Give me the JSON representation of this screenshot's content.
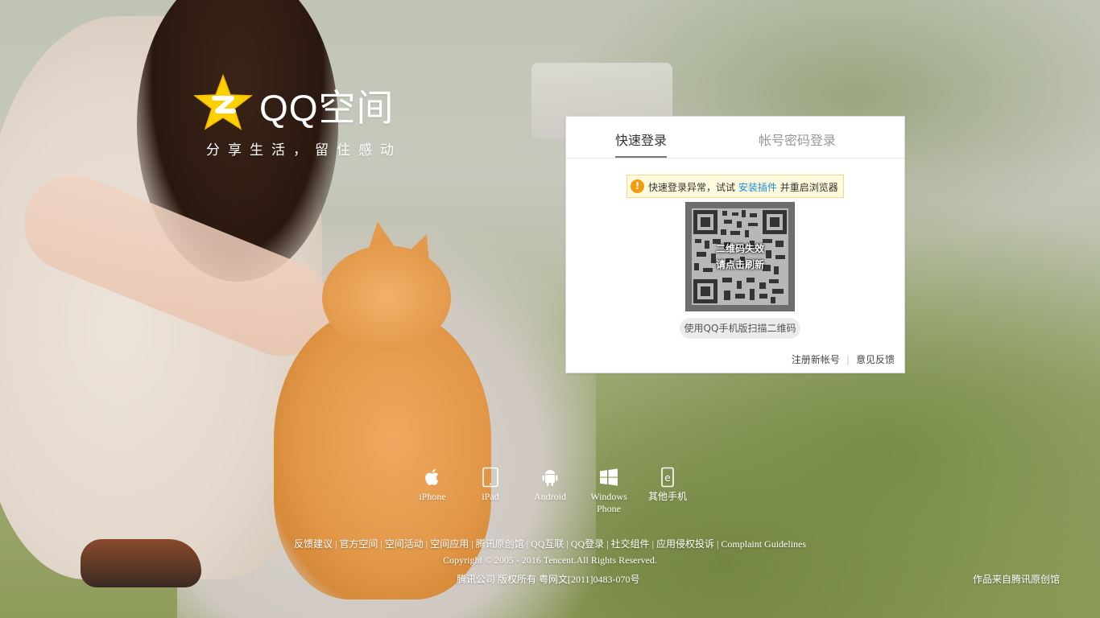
{
  "brand": {
    "name": "QQ空间",
    "slogan": "分享生活，留住感动",
    "star_color": "#fdd000"
  },
  "login": {
    "tabs": [
      {
        "label": "快速登录",
        "active": true
      },
      {
        "label": "帐号密码登录",
        "active": false
      }
    ],
    "alert": {
      "prefix": "快速登录异常，试试",
      "link": "安装插件",
      "suffix": "并重启浏览器",
      "icon": "warning-icon",
      "icon_glyph": "!"
    },
    "qr": {
      "expired_line1": "二维码失效",
      "expired_line2": "请点击刷新"
    },
    "scan_hint": "使用QQ手机版扫描二维码",
    "register": "注册新帐号",
    "separator": "|",
    "feedback": "意见反馈",
    "accent_color": "#1a8bd8"
  },
  "devices": [
    {
      "label": "iPhone",
      "icon": "apple-icon"
    },
    {
      "label": "iPad",
      "icon": "ipad-icon"
    },
    {
      "label": "Android",
      "icon": "android-icon"
    },
    {
      "label": "Windows Phone",
      "icon": "windows-icon"
    },
    {
      "label": "其他手机",
      "icon": "other-phone-icon"
    }
  ],
  "footer": {
    "links": [
      "反馈建议",
      "官方空间",
      "空间活动",
      "空间应用",
      "腾讯原创馆",
      "QQ互联",
      "QQ登录",
      "社交组件",
      "应用侵权投诉",
      "Complaint Guidelines"
    ],
    "separator": "|",
    "copyright": "Copyright © 2005 - 2016 Tencent.All Rights Reserved.",
    "license": "腾讯公司 版权所有 粤网文[2011]0483-070号",
    "credit": "作品来自腾讯原创馆"
  }
}
